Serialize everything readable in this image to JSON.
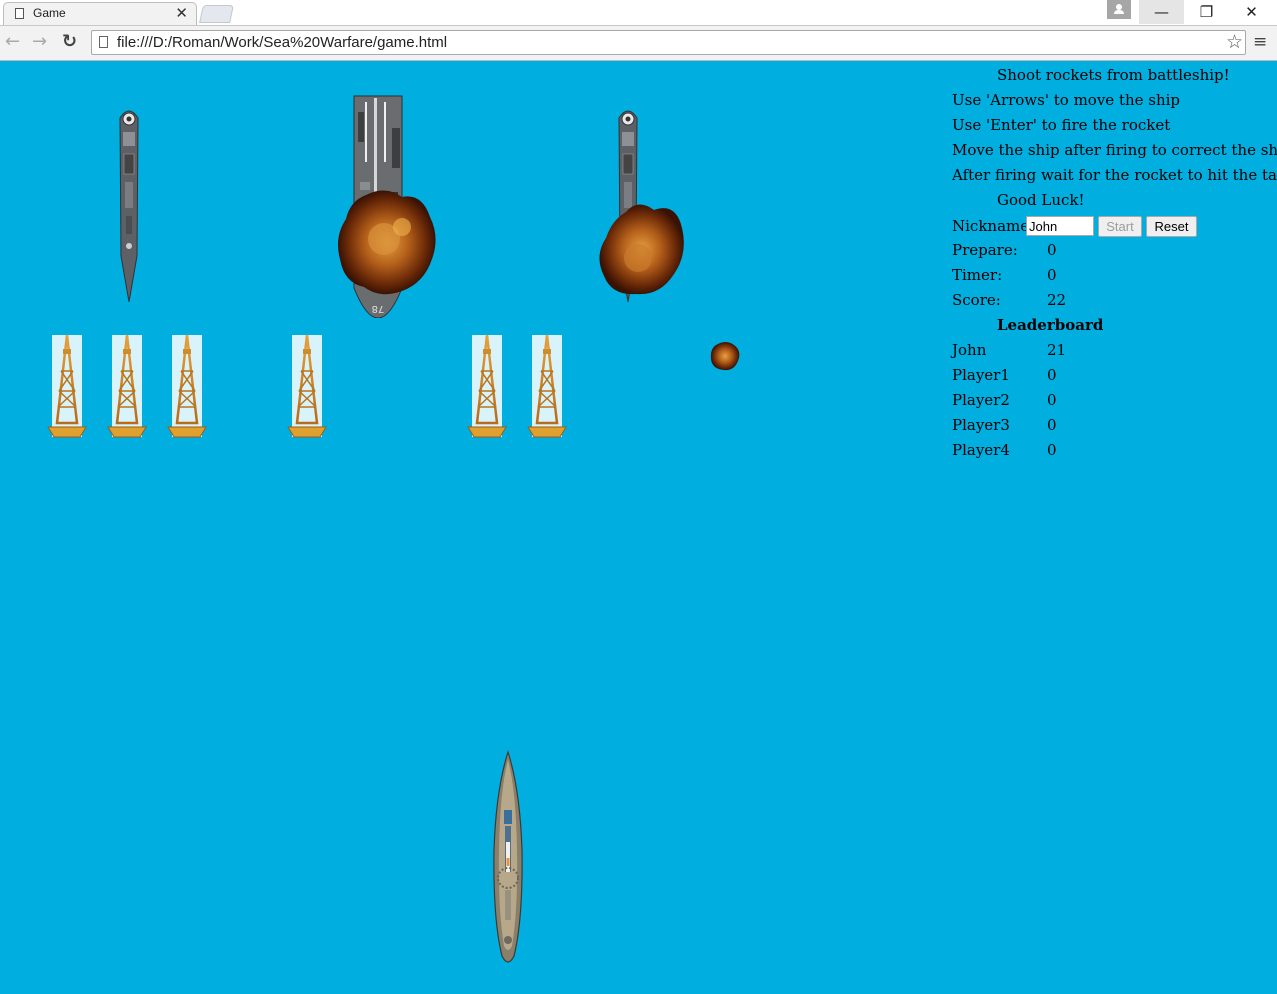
{
  "browser": {
    "tab_title": "Game",
    "tab_close": "✕",
    "url": "file:///D:/Roman/Work/Sea%20Warfare/game.html",
    "icons": {
      "back": "←",
      "forward": "→",
      "reload": "↻",
      "star": "☆",
      "menu": "≡",
      "minimize": "—",
      "restore": "❐",
      "close": "✕"
    }
  },
  "instructions": {
    "heading": "Shoot rockets from battleship!",
    "lines": [
      "Use 'Arrows' to move the ship",
      "Use 'Enter' to fire the rocket",
      "Move the ship after firing to correct the shot",
      "After firing wait for the rocket to hit the target"
    ],
    "good_luck": "Good Luck!"
  },
  "controls": {
    "nickname_label": "Nickname:",
    "nickname_value": "John",
    "start_label": "Start",
    "reset_label": "Reset"
  },
  "stats": {
    "prepare_label": "Prepare:",
    "prepare_value": "0",
    "timer_label": "Timer:",
    "timer_value": "0",
    "score_label": "Score:",
    "score_value": "22"
  },
  "leaderboard": {
    "title": "Leaderboard",
    "entries": [
      {
        "name": "John",
        "score": "21"
      },
      {
        "name": "Player1",
        "score": "0"
      },
      {
        "name": "Player2",
        "score": "0"
      },
      {
        "name": "Player3",
        "score": "0"
      },
      {
        "name": "Player4",
        "score": "0"
      }
    ]
  },
  "sprites": {
    "carrier_hull_number": "78"
  }
}
